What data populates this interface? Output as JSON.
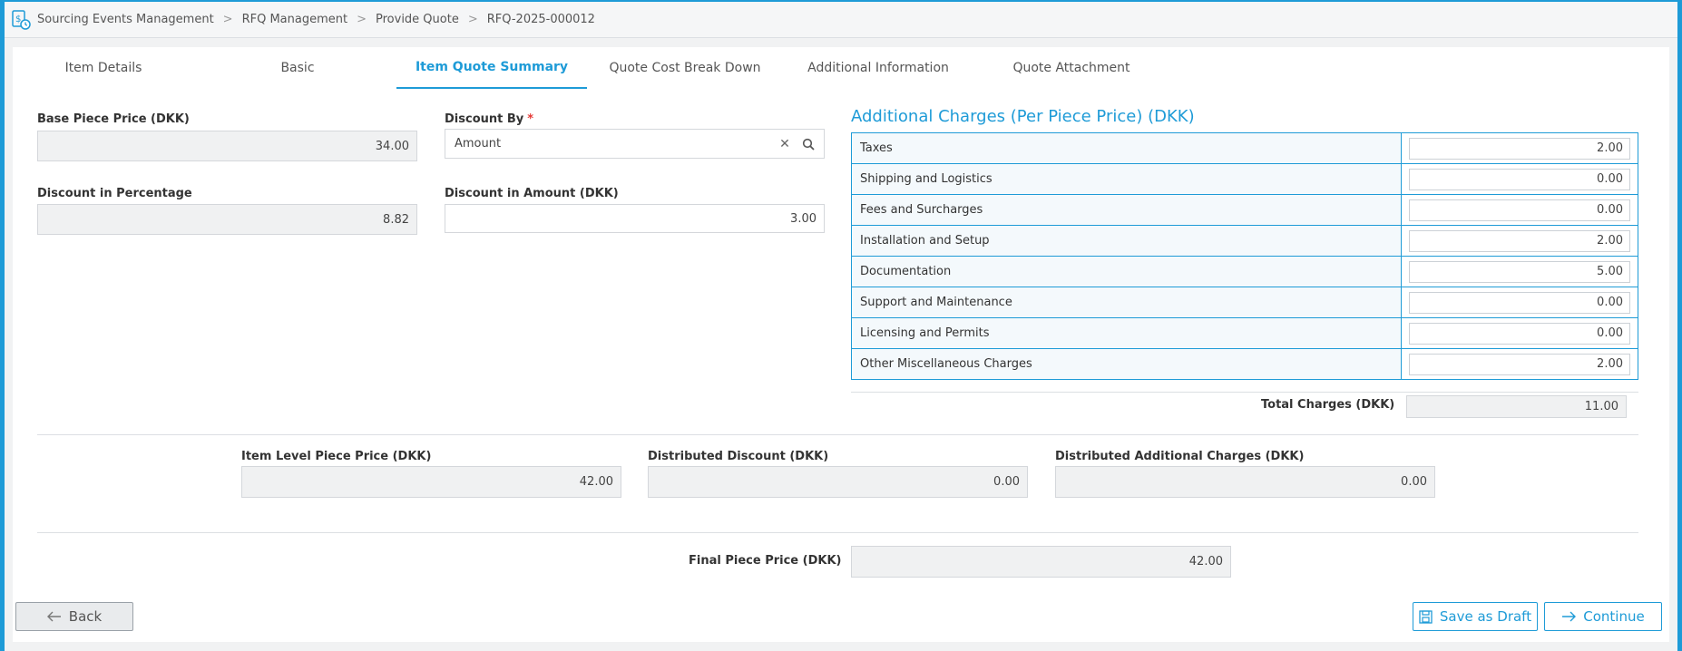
{
  "breadcrumb": {
    "items": [
      "Sourcing Events Management",
      "RFQ Management",
      "Provide Quote",
      "RFQ-2025-000012"
    ]
  },
  "tabs": [
    {
      "label": "Item Details"
    },
    {
      "label": "Basic"
    },
    {
      "label": "Item Quote Summary",
      "active": true
    },
    {
      "label": "Quote Cost Break Down"
    },
    {
      "label": "Additional Information"
    },
    {
      "label": "Quote Attachment"
    }
  ],
  "form": {
    "base_piece_price_label": "Base Piece Price (DKK)",
    "base_piece_price": "34.00",
    "discount_by_label": "Discount By",
    "discount_by_required": "*",
    "discount_by": "Amount",
    "discount_percentage_label": "Discount in Percentage",
    "discount_percentage": "8.82",
    "discount_amount_label": "Discount in Amount (DKK)",
    "discount_amount": "3.00"
  },
  "charges": {
    "title": "Additional Charges (Per Piece Price) (DKK)",
    "rows": [
      {
        "name": "Taxes",
        "value": "2.00"
      },
      {
        "name": "Shipping and Logistics",
        "value": "0.00"
      },
      {
        "name": "Fees and Surcharges",
        "value": "0.00"
      },
      {
        "name": "Installation and Setup",
        "value": "2.00"
      },
      {
        "name": "Documentation",
        "value": "5.00"
      },
      {
        "name": "Support and Maintenance",
        "value": "0.00"
      },
      {
        "name": "Licensing and Permits",
        "value": "0.00"
      },
      {
        "name": "Other Miscellaneous Charges",
        "value": "2.00"
      }
    ],
    "total_label": "Total Charges (DKK)",
    "total": "11.00"
  },
  "summary": {
    "item_level_label": "Item Level Piece Price (DKK)",
    "item_level": "42.00",
    "distributed_discount_label": "Distributed Discount (DKK)",
    "distributed_discount": "0.00",
    "distributed_charges_label": "Distributed Additional Charges (DKK)",
    "distributed_charges": "0.00",
    "final_price_label": "Final Piece Price (DKK)",
    "final_price": "42.00"
  },
  "buttons": {
    "back": "Back",
    "save_draft": "Save as Draft",
    "continue": "Continue"
  },
  "colors": {
    "accent": "#1e9bd7",
    "required": "#e53935"
  }
}
